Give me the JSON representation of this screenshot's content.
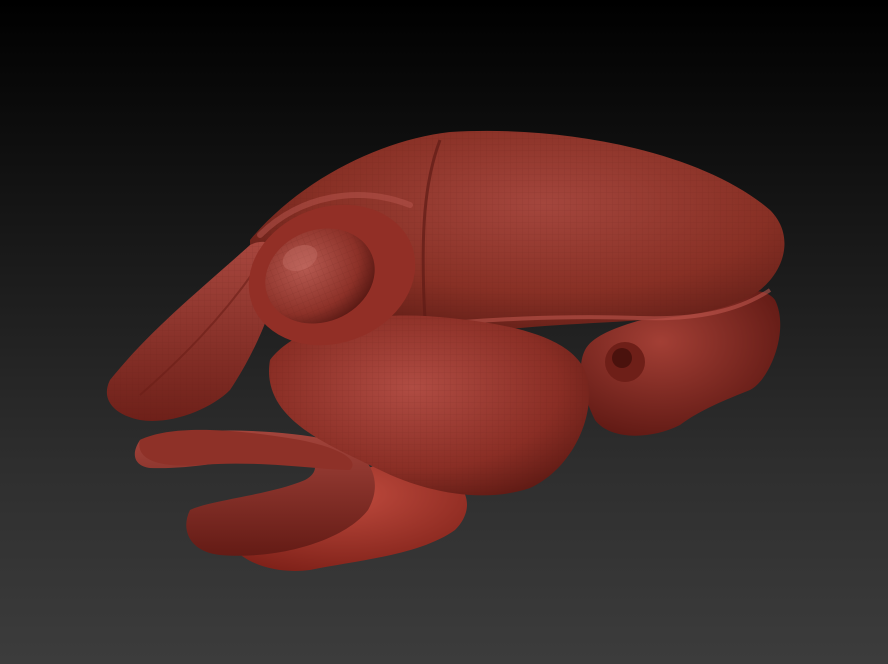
{
  "scene": {
    "subject": "sculpted-skull-model",
    "material_color": "#8a2e25",
    "highlight_color": "#b5524a",
    "shadow_color": "#4a1410",
    "background_top": "#000000",
    "background_bottom": "#3c3c3c"
  }
}
